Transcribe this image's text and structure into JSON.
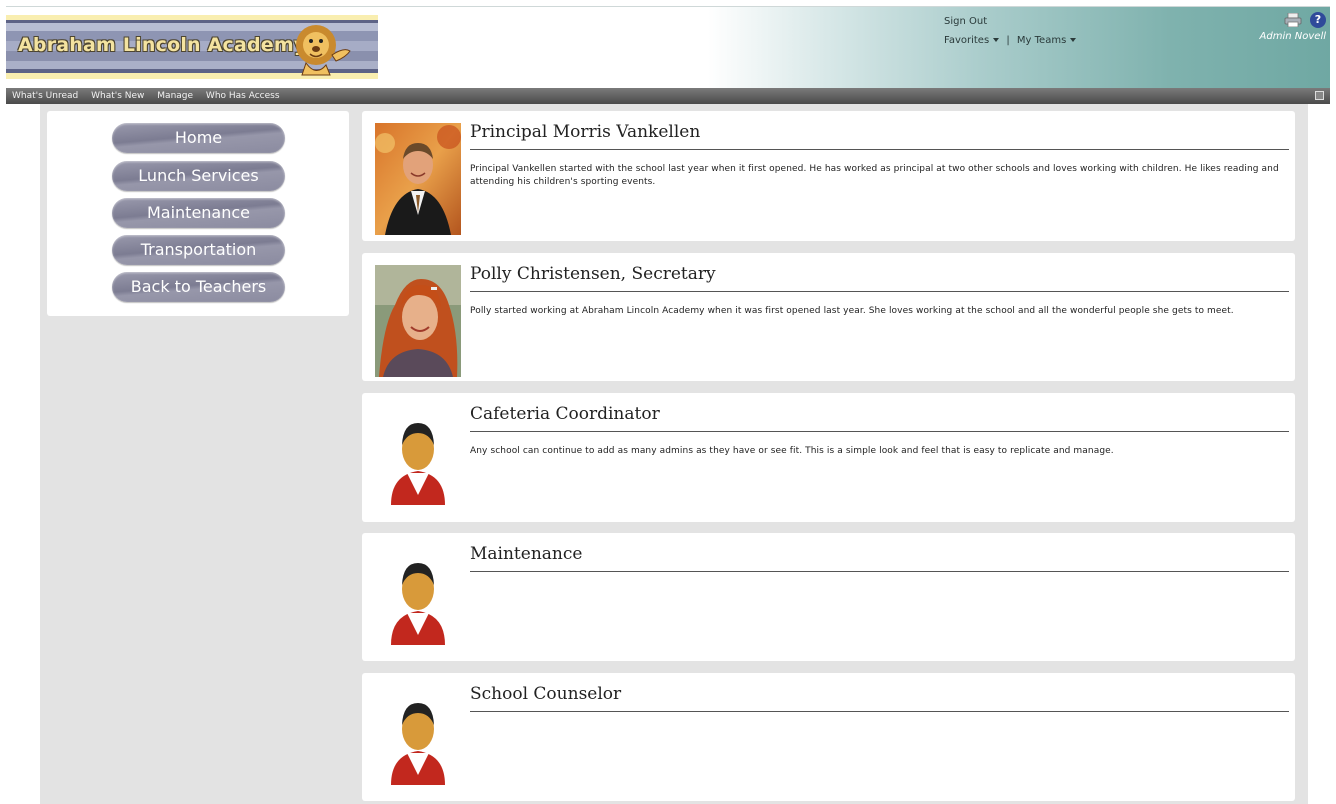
{
  "header": {
    "school_name": "Abraham Lincoln Academy",
    "sign_out": "Sign Out",
    "favorites": "Favorites",
    "separator": "|",
    "my_teams": "My Teams",
    "user_name": "Admin Novell",
    "help_glyph": "?"
  },
  "nav": {
    "items": [
      "What's Unread",
      "What's New",
      "Manage",
      "Who Has Access"
    ]
  },
  "sidebar": {
    "buttons": [
      "Home",
      "Lunch Services",
      "Maintenance",
      "Transportation",
      "Back to Teachers"
    ]
  },
  "staff": [
    {
      "name": "Principal Morris Vankellen",
      "description": "Principal Vankellen started with the school last year when it first opened. He has worked as principal at two other schools and loves working with children. He likes reading and attending his children's sporting events.",
      "photo": "photo-man"
    },
    {
      "name": "Polly Christensen, Secretary",
      "description": "Polly started working at Abraham Lincoln Academy when it was first opened last year. She loves working at the school and all the wonderful people she gets to meet.",
      "photo": "photo-woman"
    },
    {
      "name": "Cafeteria Coordinator",
      "description": "Any school can continue to add as many admins as they have or see fit. This is a simple look and feel that is easy to replicate and manage.",
      "photo": "avatar-placeholder"
    },
    {
      "name": "Maintenance",
      "description": "",
      "photo": "avatar-placeholder"
    },
    {
      "name": "School Counselor",
      "description": "",
      "photo": "avatar-placeholder"
    }
  ],
  "icons": {
    "print": "print-icon",
    "help": "help-icon",
    "logo": "lion-mascot-icon"
  },
  "colors": {
    "nav_bg": "#555555",
    "pill": "#8b8ba0",
    "header_teal": "#6fa8a3"
  }
}
